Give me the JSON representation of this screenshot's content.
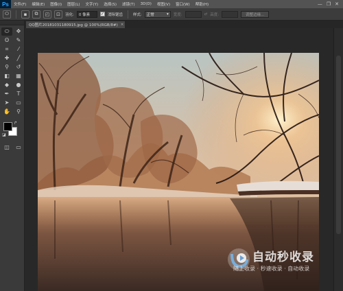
{
  "app": {
    "logo": "Ps"
  },
  "menu": [
    "文件(F)",
    "编辑(E)",
    "图像(I)",
    "图层(L)",
    "文字(Y)",
    "选择(S)",
    "滤镜(T)",
    "3D(D)",
    "视图(V)",
    "窗口(W)",
    "帮助(H)"
  ],
  "window_controls": {
    "minimize": "—",
    "restore": "❐",
    "close": "✕"
  },
  "options": {
    "feather_label": "羽化:",
    "feather_value": "0 像素",
    "antialias_label": "消除锯齿",
    "style_label": "样式:",
    "style_value": "正常",
    "width_label": "宽度:",
    "height_label": "高度:",
    "refine_button": "调整边缘..."
  },
  "document": {
    "tab_title": "QQ图片20181031180915.jpg @ 100%(RGB/8#)",
    "tab_close": "×"
  },
  "watermark": {
    "title": "自动秒收录",
    "subtitle": "随上收录 · 秒速收录 · 自动收录"
  },
  "tools": [
    {
      "name": "marquee-tool",
      "glyph": "⬭"
    },
    {
      "name": "move-tool",
      "glyph": "✥"
    },
    {
      "name": "lasso-tool",
      "glyph": "ʘ"
    },
    {
      "name": "quick-select-tool",
      "glyph": "✎"
    },
    {
      "name": "crop-tool",
      "glyph": "⌗"
    },
    {
      "name": "eyedropper-tool",
      "glyph": "⁄"
    },
    {
      "name": "healing-tool",
      "glyph": "✚"
    },
    {
      "name": "brush-tool",
      "glyph": "╱"
    },
    {
      "name": "clone-stamp-tool",
      "glyph": "⚲"
    },
    {
      "name": "history-brush-tool",
      "glyph": "↺"
    },
    {
      "name": "eraser-tool",
      "glyph": "◧"
    },
    {
      "name": "gradient-tool",
      "glyph": "▦"
    },
    {
      "name": "blur-tool",
      "glyph": "◆"
    },
    {
      "name": "dodge-tool",
      "glyph": "●"
    },
    {
      "name": "pen-tool",
      "glyph": "✒"
    },
    {
      "name": "type-tool",
      "glyph": "T"
    },
    {
      "name": "path-select-tool",
      "glyph": "➤"
    },
    {
      "name": "shape-tool",
      "glyph": "▭"
    },
    {
      "name": "hand-tool",
      "glyph": "✋"
    },
    {
      "name": "zoom-tool",
      "glyph": "⚲"
    }
  ],
  "colors": {
    "foreground": "#000000",
    "background": "#ffffff",
    "ui_dark": "#282828",
    "menu_bg": "#535353"
  }
}
